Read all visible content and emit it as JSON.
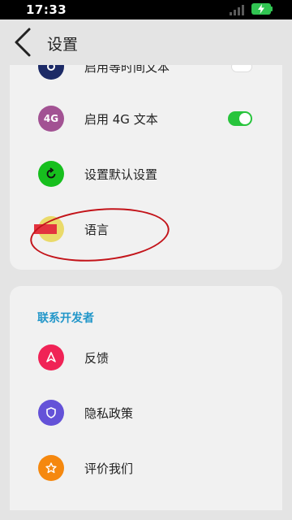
{
  "status_bar": {
    "time": "17:33",
    "icons": [
      "signal-icon",
      "battery-charging-icon"
    ]
  },
  "header": {
    "title": "设置",
    "back_icon": "chevron-left-icon"
  },
  "settings_card": {
    "items": [
      {
        "label": "启用等时间文本",
        "icon": "dark-circle-icon",
        "icon_color": "#1c2a66",
        "toggle": "off"
      },
      {
        "label": "启用 4G 文本",
        "icon_text": "4G",
        "icon_color": "#a25293",
        "toggle": "on"
      },
      {
        "label": "设置默认设置",
        "icon": "refresh-icon",
        "icon_color": "#17bf1e"
      },
      {
        "label": "语言",
        "icon": "flag-icon",
        "icon_color": "#eada6a",
        "flag_color": "#e3333f"
      }
    ]
  },
  "developer_card": {
    "section_title": "联系开发者",
    "items": [
      {
        "label": "反馈",
        "icon": "send-icon",
        "icon_color": "#f02356"
      },
      {
        "label": "隐私政策",
        "icon": "shield-icon",
        "icon_color": "#6452d8"
      },
      {
        "label": "评价我们",
        "icon": "star-icon",
        "icon_color": "#f5880f"
      }
    ]
  },
  "annotation": {
    "color": "#c3141a",
    "target": "语言"
  }
}
